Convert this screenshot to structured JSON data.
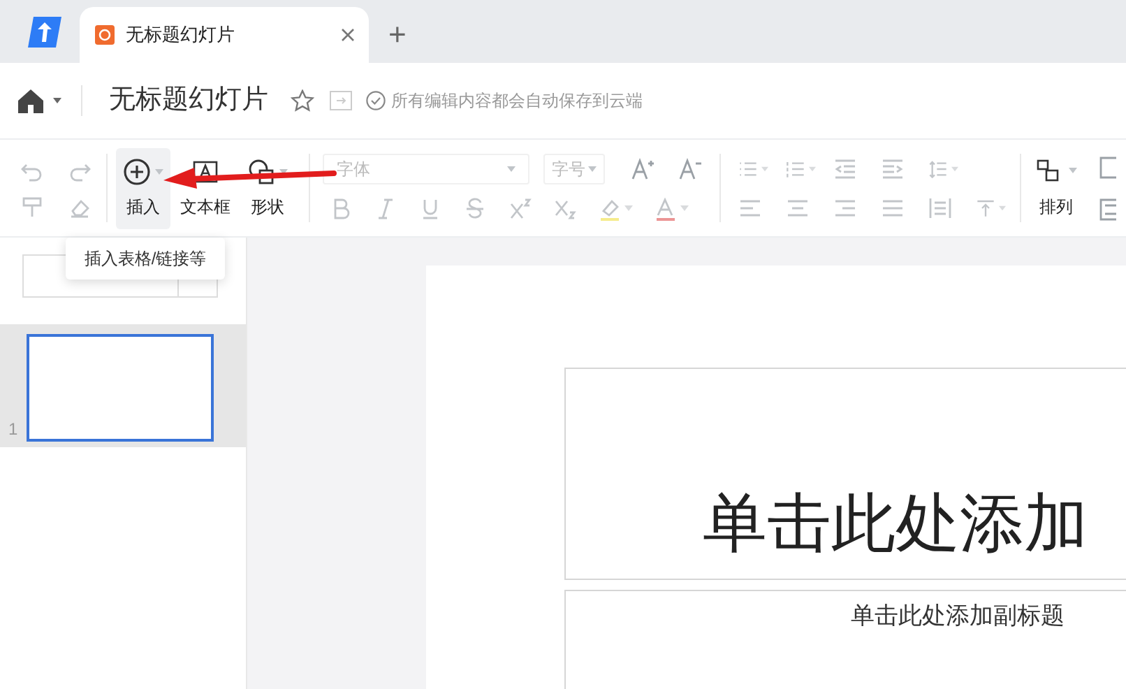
{
  "tab_bar": {
    "tabs": [
      {
        "title": "无标题幻灯片",
        "selected": true
      }
    ],
    "new_tab": "+"
  },
  "header": {
    "title": "无标题幻灯片",
    "save_status": "所有编辑内容都会自动保存到云端"
  },
  "toolbar": {
    "history_buttons": [
      {
        "disabled": true
      },
      {
        "disabled": true
      },
      {
        "disabled": true
      },
      {
        "disabled": true
      }
    ],
    "insert_buttons": [
      {
        "label": "插入",
        "hovered": true
      },
      {
        "label": "文本框",
        "hovered": false
      },
      {
        "label": "形状",
        "hovered": false
      }
    ],
    "font_select": {
      "placeholder": "字体"
    },
    "size_select": {
      "placeholder": "字号"
    },
    "format_buttons": [
      {
        "disabled": true
      },
      {
        "disabled": true
      },
      {
        "disabled": true
      },
      {
        "disabled": true
      },
      {
        "disabled": true
      },
      {
        "disabled": true
      },
      {
        "disabled": true
      },
      {
        "disabled": true
      }
    ],
    "paragraph_buttons": [
      {
        "disabled": true
      },
      {
        "disabled": true
      },
      {
        "disabled": true
      },
      {
        "disabled": true
      },
      {
        "disabled": true
      },
      {
        "disabled": true
      },
      {
        "disabled": true
      },
      {
        "disabled": true
      },
      {
        "disabled": true
      },
      {
        "disabled": true
      },
      {
        "disabled": true
      }
    ],
    "arrange": {
      "label": "排列"
    }
  },
  "tooltip": "插入表格/链接等",
  "slides_panel": {
    "slides": [
      {
        "number": "1",
        "selected": true
      }
    ]
  },
  "slide": {
    "title_placeholder": "单击此处添加",
    "subtitle_placeholder": "单击此处添加副标题"
  }
}
